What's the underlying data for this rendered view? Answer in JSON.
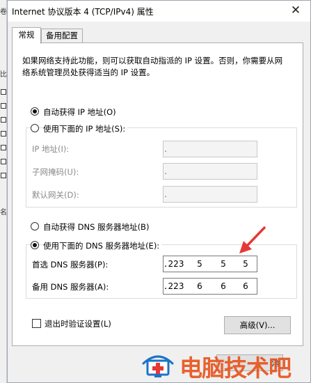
{
  "background_window": {
    "glyphs": [
      "卷",
      "比",
      "名"
    ]
  },
  "window": {
    "title": "Internet 协议版本 4 (TCP/IPv4) 属性",
    "close_glyph": "✕"
  },
  "tabs": [
    {
      "label": "常规",
      "active": true
    },
    {
      "label": "备用配置",
      "active": false
    }
  ],
  "description": {
    "line1": "如果网络支持此功能，则可以获取自动指派的 IP 设置。否则，你需要从网",
    "line2": "络系统管理员处获得适当的 IP 设置。"
  },
  "ip_section": {
    "auto_label": "自动获得 IP 地址(O)",
    "manual_label": "使用下面的 IP 地址(S):",
    "selected": "auto",
    "fields": [
      {
        "label": "IP 地址(I):",
        "octets": [
          "",
          "",
          "",
          ""
        ]
      },
      {
        "label": "子网掩码(U):",
        "octets": [
          "",
          "",
          "",
          ""
        ]
      },
      {
        "label": "默认网关(D):",
        "octets": [
          "",
          "",
          "",
          ""
        ]
      }
    ]
  },
  "dns_section": {
    "auto_label": "自动获得 DNS 服务器地址(B)",
    "manual_label": "使用下面的 DNS 服务器地址(E):",
    "selected": "manual",
    "preferred_label": "首选 DNS 服务器(P):",
    "preferred_octets": [
      "223",
      "5",
      "5",
      "5"
    ],
    "alternate_label": "备用 DNS 服务器(A):",
    "alternate_octets": [
      "223",
      "6",
      "6",
      "6"
    ]
  },
  "footer": {
    "validate_label": "退出时验证设置(L)",
    "validate_checked": false,
    "advanced_label": "高级(V)...",
    "partial_button_text": "消"
  },
  "watermark": {
    "text": "电脑技术吧",
    "colors": {
      "text": "#e8551e",
      "icon_blue": "#1a73c8",
      "icon_red": "#e53935"
    }
  },
  "annotation": {
    "arrow_color": "#e53935"
  }
}
